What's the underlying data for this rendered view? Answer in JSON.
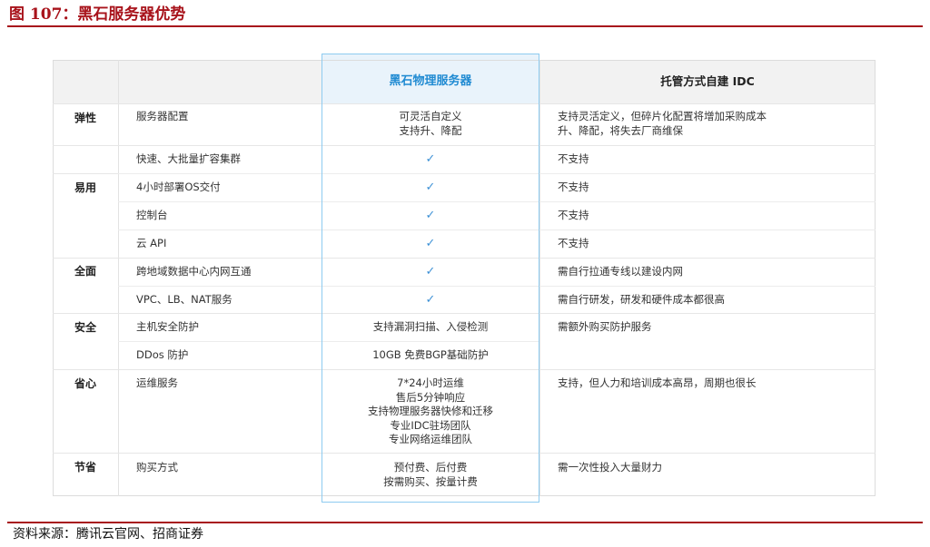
{
  "figure_title": "图 107：黑石服务器优势",
  "source": "资料来源：腾讯云官网、招商证券",
  "table": {
    "col_headers": [
      "黑石物理服务器",
      "托管方式自建 IDC"
    ],
    "rows": [
      {
        "category": "弹性",
        "feature": "服务器配置",
        "blackstone": [
          "可灵活自定义",
          "支持升、降配"
        ],
        "idc": [
          "支持灵活定义，但碎片化配置将增加采购成本",
          "升、降配，将失去厂商维保"
        ]
      },
      {
        "category": "",
        "feature": "快速、大批量扩容集群",
        "blackstone": "✓",
        "idc": "不支持"
      },
      {
        "category": "易用",
        "feature": "4小时部署OS交付",
        "blackstone": "✓",
        "idc": "不支持"
      },
      {
        "category": "",
        "feature": "控制台",
        "blackstone": "✓",
        "idc": "不支持"
      },
      {
        "category": "",
        "feature": "云 API",
        "blackstone": "✓",
        "idc": "不支持"
      },
      {
        "category": "全面",
        "feature": "跨地域数据中心内网互通",
        "blackstone": "✓",
        "idc": "需自行拉通专线以建设内网"
      },
      {
        "category": "",
        "feature": "VPC、LB、NAT服务",
        "blackstone": "✓",
        "idc": "需自行研发，研发和硬件成本都很高"
      },
      {
        "category": "安全",
        "feature": "主机安全防护",
        "blackstone": "支持漏洞扫描、入侵检测",
        "idc": "需额外购买防护服务"
      },
      {
        "category": "",
        "feature": "DDos 防护",
        "blackstone": "10GB 免费BGP基础防护",
        "idc": ""
      },
      {
        "category": "省心",
        "feature": "运维服务",
        "blackstone": [
          "7*24小时运维",
          "售后5分钟响应",
          "支持物理服务器快修和迁移",
          "专业IDC驻场团队",
          "专业网络运维团队"
        ],
        "idc": "支持，但人力和培训成本高昂，周期也很长"
      },
      {
        "category": "节省",
        "feature": "购买方式",
        "blackstone": [
          "预付费、后付费",
          "按需购买、按量计费"
        ],
        "idc": "需一次性投入大量财力"
      }
    ]
  }
}
